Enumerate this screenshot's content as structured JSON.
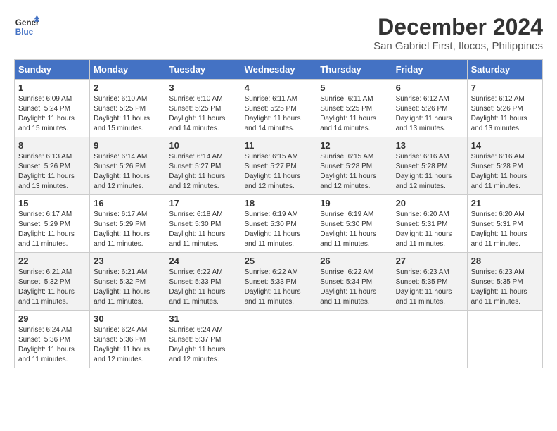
{
  "logo": {
    "line1": "General",
    "line2": "Blue"
  },
  "title": {
    "month": "December 2024",
    "location": "San Gabriel First, Ilocos, Philippines"
  },
  "weekdays": [
    "Sunday",
    "Monday",
    "Tuesday",
    "Wednesday",
    "Thursday",
    "Friday",
    "Saturday"
  ],
  "weeks": [
    [
      {
        "day": "1",
        "sunrise": "6:09 AM",
        "sunset": "5:24 PM",
        "daylight": "11 hours and 15 minutes."
      },
      {
        "day": "2",
        "sunrise": "6:10 AM",
        "sunset": "5:25 PM",
        "daylight": "11 hours and 15 minutes."
      },
      {
        "day": "3",
        "sunrise": "6:10 AM",
        "sunset": "5:25 PM",
        "daylight": "11 hours and 14 minutes."
      },
      {
        "day": "4",
        "sunrise": "6:11 AM",
        "sunset": "5:25 PM",
        "daylight": "11 hours and 14 minutes."
      },
      {
        "day": "5",
        "sunrise": "6:11 AM",
        "sunset": "5:25 PM",
        "daylight": "11 hours and 14 minutes."
      },
      {
        "day": "6",
        "sunrise": "6:12 AM",
        "sunset": "5:26 PM",
        "daylight": "11 hours and 13 minutes."
      },
      {
        "day": "7",
        "sunrise": "6:12 AM",
        "sunset": "5:26 PM",
        "daylight": "11 hours and 13 minutes."
      }
    ],
    [
      {
        "day": "8",
        "sunrise": "6:13 AM",
        "sunset": "5:26 PM",
        "daylight": "11 hours and 13 minutes."
      },
      {
        "day": "9",
        "sunrise": "6:14 AM",
        "sunset": "5:26 PM",
        "daylight": "11 hours and 12 minutes."
      },
      {
        "day": "10",
        "sunrise": "6:14 AM",
        "sunset": "5:27 PM",
        "daylight": "11 hours and 12 minutes."
      },
      {
        "day": "11",
        "sunrise": "6:15 AM",
        "sunset": "5:27 PM",
        "daylight": "11 hours and 12 minutes."
      },
      {
        "day": "12",
        "sunrise": "6:15 AM",
        "sunset": "5:28 PM",
        "daylight": "11 hours and 12 minutes."
      },
      {
        "day": "13",
        "sunrise": "6:16 AM",
        "sunset": "5:28 PM",
        "daylight": "11 hours and 12 minutes."
      },
      {
        "day": "14",
        "sunrise": "6:16 AM",
        "sunset": "5:28 PM",
        "daylight": "11 hours and 11 minutes."
      }
    ],
    [
      {
        "day": "15",
        "sunrise": "6:17 AM",
        "sunset": "5:29 PM",
        "daylight": "11 hours and 11 minutes."
      },
      {
        "day": "16",
        "sunrise": "6:17 AM",
        "sunset": "5:29 PM",
        "daylight": "11 hours and 11 minutes."
      },
      {
        "day": "17",
        "sunrise": "6:18 AM",
        "sunset": "5:30 PM",
        "daylight": "11 hours and 11 minutes."
      },
      {
        "day": "18",
        "sunrise": "6:19 AM",
        "sunset": "5:30 PM",
        "daylight": "11 hours and 11 minutes."
      },
      {
        "day": "19",
        "sunrise": "6:19 AM",
        "sunset": "5:30 PM",
        "daylight": "11 hours and 11 minutes."
      },
      {
        "day": "20",
        "sunrise": "6:20 AM",
        "sunset": "5:31 PM",
        "daylight": "11 hours and 11 minutes."
      },
      {
        "day": "21",
        "sunrise": "6:20 AM",
        "sunset": "5:31 PM",
        "daylight": "11 hours and 11 minutes."
      }
    ],
    [
      {
        "day": "22",
        "sunrise": "6:21 AM",
        "sunset": "5:32 PM",
        "daylight": "11 hours and 11 minutes."
      },
      {
        "day": "23",
        "sunrise": "6:21 AM",
        "sunset": "5:32 PM",
        "daylight": "11 hours and 11 minutes."
      },
      {
        "day": "24",
        "sunrise": "6:22 AM",
        "sunset": "5:33 PM",
        "daylight": "11 hours and 11 minutes."
      },
      {
        "day": "25",
        "sunrise": "6:22 AM",
        "sunset": "5:33 PM",
        "daylight": "11 hours and 11 minutes."
      },
      {
        "day": "26",
        "sunrise": "6:22 AM",
        "sunset": "5:34 PM",
        "daylight": "11 hours and 11 minutes."
      },
      {
        "day": "27",
        "sunrise": "6:23 AM",
        "sunset": "5:35 PM",
        "daylight": "11 hours and 11 minutes."
      },
      {
        "day": "28",
        "sunrise": "6:23 AM",
        "sunset": "5:35 PM",
        "daylight": "11 hours and 11 minutes."
      }
    ],
    [
      {
        "day": "29",
        "sunrise": "6:24 AM",
        "sunset": "5:36 PM",
        "daylight": "11 hours and 11 minutes."
      },
      {
        "day": "30",
        "sunrise": "6:24 AM",
        "sunset": "5:36 PM",
        "daylight": "11 hours and 12 minutes."
      },
      {
        "day": "31",
        "sunrise": "6:24 AM",
        "sunset": "5:37 PM",
        "daylight": "11 hours and 12 minutes."
      },
      null,
      null,
      null,
      null
    ]
  ],
  "labels": {
    "sunrise": "Sunrise:",
    "sunset": "Sunset:",
    "daylight": "Daylight:"
  }
}
